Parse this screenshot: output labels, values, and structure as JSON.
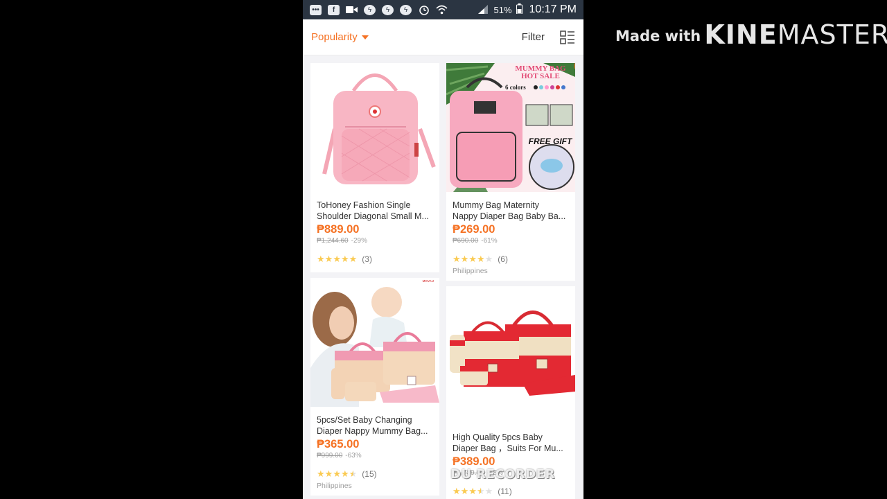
{
  "watermark": {
    "prefix": "Made with",
    "brand_a": "KINE",
    "brand_b": "MASTER"
  },
  "status_bar": {
    "battery": "51%",
    "time": "10:17 PM",
    "icons": [
      "chat-icon",
      "facebook-icon",
      "video-icon",
      "messenger-icon",
      "messenger-icon",
      "messenger-icon",
      "alarm-icon",
      "wifi-icon",
      "signal-icon",
      "battery-icon"
    ]
  },
  "toolbar": {
    "sort_label": "Popularity",
    "filter_label": "Filter"
  },
  "products": [
    {
      "title_line1": "ToHoney Fashion Single",
      "title_line2": "Shoulder Diagonal Small M...",
      "price": "₱889.00",
      "original_price": "₱1,244.60",
      "discount": "-29%",
      "rating": 5,
      "reviews": "(3)",
      "location": ""
    },
    {
      "title_line1": "Mummy Bag Maternity",
      "title_line2": "Nappy Diaper Bag Baby Ba...",
      "price": "₱269.00",
      "original_price": "₱690.00",
      "discount": "-61%",
      "rating": 4,
      "reviews": "(6)",
      "location": "Philippines",
      "banner_text_1": "MUMMY BAG",
      "banner_text_2": "HOT SALE",
      "banner_text_3": "6 colors",
      "banner_text_4": "FREE GIFT"
    },
    {
      "title_line1": "5pcs/Set Baby Changing",
      "title_line2": "Diaper Nappy Mummy Bag...",
      "price": "₱365.00",
      "original_price": "₱999.00",
      "discount": "-63%",
      "rating": 4.5,
      "reviews": "(15)",
      "location": "Philippines",
      "brand_text": "MOVAU"
    },
    {
      "title_line1": "High Quality 5pcs Baby",
      "title_line2": "Diaper Bag ，Suits For Mu...",
      "price": "₱389.00",
      "original_price": "₱1,789.00",
      "discount": "-78%",
      "rating": 3.5,
      "reviews": "(11)",
      "location": ""
    }
  ],
  "recorder_watermark": "DU RECORDER",
  "colors": {
    "accent": "#f57224",
    "star": "#faca51",
    "status_bar": "#2b3542"
  }
}
